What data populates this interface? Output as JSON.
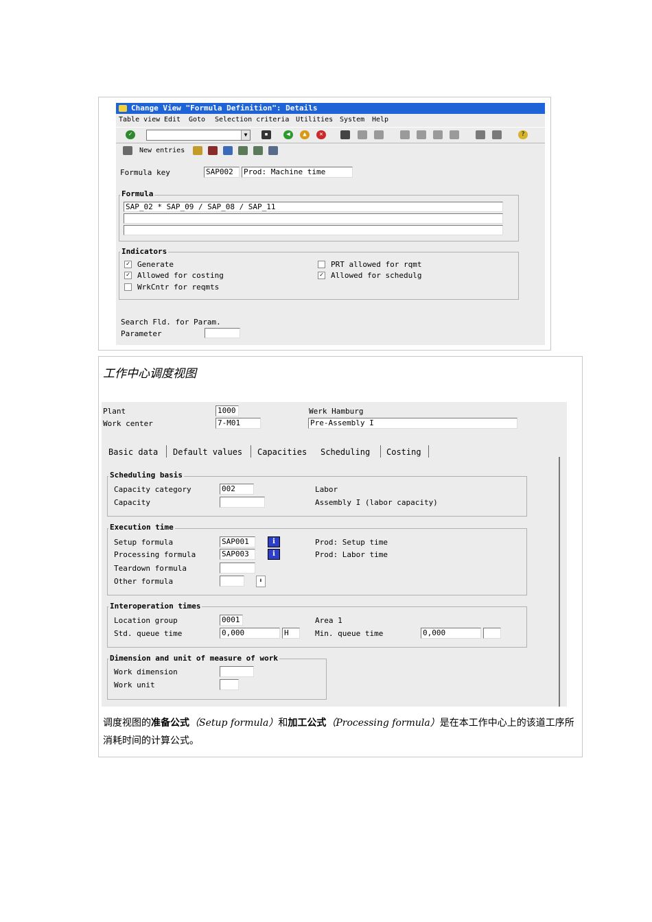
{
  "window1": {
    "title": "Change View \"Formula Definition\": Details",
    "menu": [
      "Table view",
      "Edit",
      "Goto",
      "Selection criteria",
      "Utilities",
      "System",
      "Help"
    ],
    "new_entries": "New entries",
    "formula_key_label": "Formula key",
    "formula_key_value": "SAP002",
    "formula_key_desc": "Prod: Machine time",
    "formula_group": "Formula",
    "formula_line1": "SAP_02 * SAP_09 / SAP_08 / SAP_11",
    "indicators_group": "Indicators",
    "ind_generate": "Generate",
    "ind_costing": "Allowed for costing",
    "ind_wrkcntr": "WrkCntr for reqmts",
    "ind_prt": "PRT allowed for rqmt",
    "ind_schedulg": "Allowed for schedulg",
    "search_label": "Search Fld. for Param.",
    "parameter_label": "Parameter"
  },
  "panel2": {
    "heading": "工作中心调度视图",
    "plant_label": "Plant",
    "plant_value": "1000",
    "plant_desc": "Werk Hamburg",
    "wc_label": "Work center",
    "wc_value": "7-M01",
    "wc_desc": "Pre-Assembly I",
    "tabs": [
      "Basic data",
      "Default values",
      "Capacities",
      "Scheduling",
      "Costing"
    ],
    "sched_group": "Scheduling basis",
    "cap_cat_label": "Capacity category",
    "cap_cat_value": "002",
    "cap_cat_desc": "Labor",
    "cap_label": "Capacity",
    "cap_desc": "Assembly I (labor capacity)",
    "exec_group": "Execution time",
    "setup_label": "Setup formula",
    "setup_value": "SAP001",
    "setup_desc": "Prod: Setup time",
    "proc_label": "Processing formula",
    "proc_value": "SAP003",
    "proc_desc": "Prod: Labor time",
    "teardown_label": "Teardown formula",
    "other_label": "Other formula",
    "interop_group": "Interoperation times",
    "loc_label": "Location group",
    "loc_value": "0001",
    "loc_desc": "Area 1",
    "queue_label": "Std. queue time",
    "queue_value": "0,000",
    "queue_unit": "H",
    "min_queue_label": "Min. queue time",
    "min_queue_value": "0,000",
    "dim_group": "Dimension and unit of measure of work",
    "work_dim_label": "Work dimension",
    "work_unit_label": "Work unit",
    "caption_1": "调度视图的",
    "caption_b1": "准备公式",
    "caption_i1": "（Setup formula）",
    "caption_2": "和",
    "caption_b2": "加工公式",
    "caption_i2": "（Processing formula）",
    "caption_3": "是在本工作中心上的该道工序所消耗时间的计算公式。"
  }
}
